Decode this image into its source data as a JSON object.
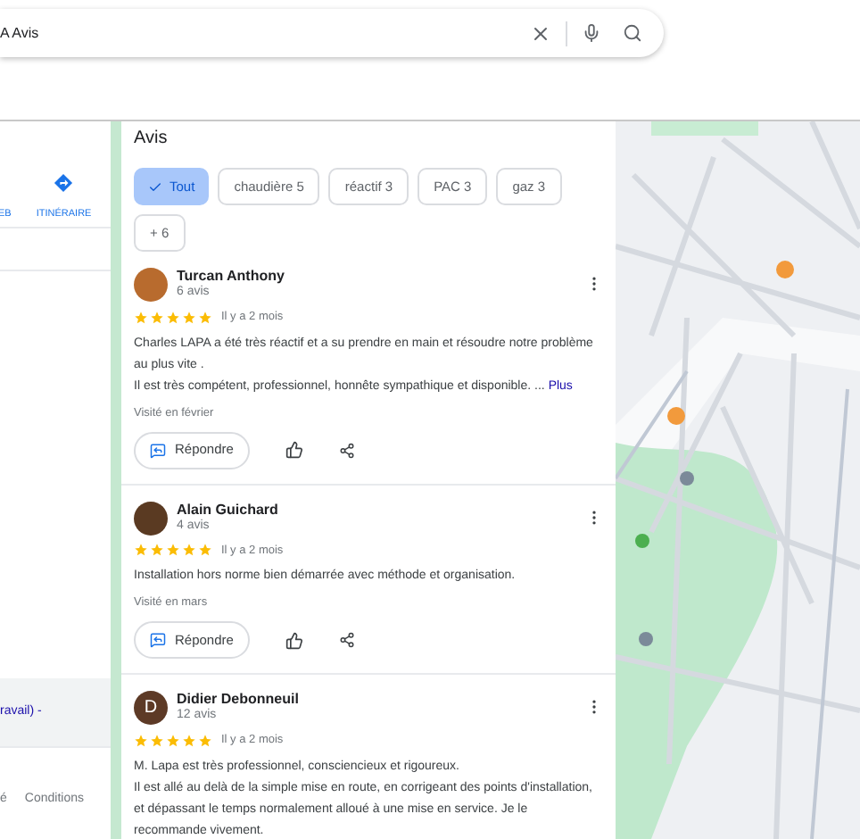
{
  "search": {
    "value": "A Avis"
  },
  "left_panel": {
    "actions": [
      {
        "label": "EB",
        "kind": "text"
      },
      {
        "label": "ITINÉRAIRE",
        "kind": "directions"
      }
    ],
    "link": "ravail) -",
    "footer": [
      "é",
      "Conditions"
    ]
  },
  "reviews": {
    "title": "Avis",
    "filters": [
      {
        "label": "Tout",
        "selected": true
      },
      {
        "label": "chaudière 5",
        "selected": false
      },
      {
        "label": "réactif 3",
        "selected": false
      },
      {
        "label": "PAC 3",
        "selected": false
      },
      {
        "label": "gaz 3",
        "selected": false
      },
      {
        "label": "+ 6",
        "selected": false
      }
    ],
    "items": [
      {
        "author": "Turcan Anthony",
        "count": "6 avis",
        "avatar": {
          "kind": "photo",
          "color": "#b86b2e"
        },
        "stars": 5,
        "time": "Il y a 2 mois",
        "text": "Charles LAPA a été très réactif et a su prendre en main et résoudre notre problème au plus vite .\nIl est très compétent, professionnel, honnête sympathique et disponible. ...",
        "more": "Plus",
        "visited": "Visité en février",
        "reply": "Répondre"
      },
      {
        "author": "Alain Guichard",
        "count": "4 avis",
        "avatar": {
          "kind": "photo",
          "color": "#5a3a22"
        },
        "stars": 5,
        "time": "Il y a 2 mois",
        "text": "Installation hors norme bien démarrée avec méthode et organisation.",
        "visited": "Visité en mars",
        "reply": "Répondre"
      },
      {
        "author": "Didier Debonneuil",
        "count": "12 avis",
        "avatar": {
          "kind": "letter",
          "letter": "D",
          "color": "#5d3a26"
        },
        "stars": 5,
        "time": "Il y a 2 mois",
        "text": "M. Lapa est très professionnel, consciencieux et rigoureux.\nIl est allé au delà de la simple mise en route, en corrigeant des points d'installation, et dépassant le temps normalement alloué à une mise en service. Je le recommande vivement."
      }
    ]
  }
}
